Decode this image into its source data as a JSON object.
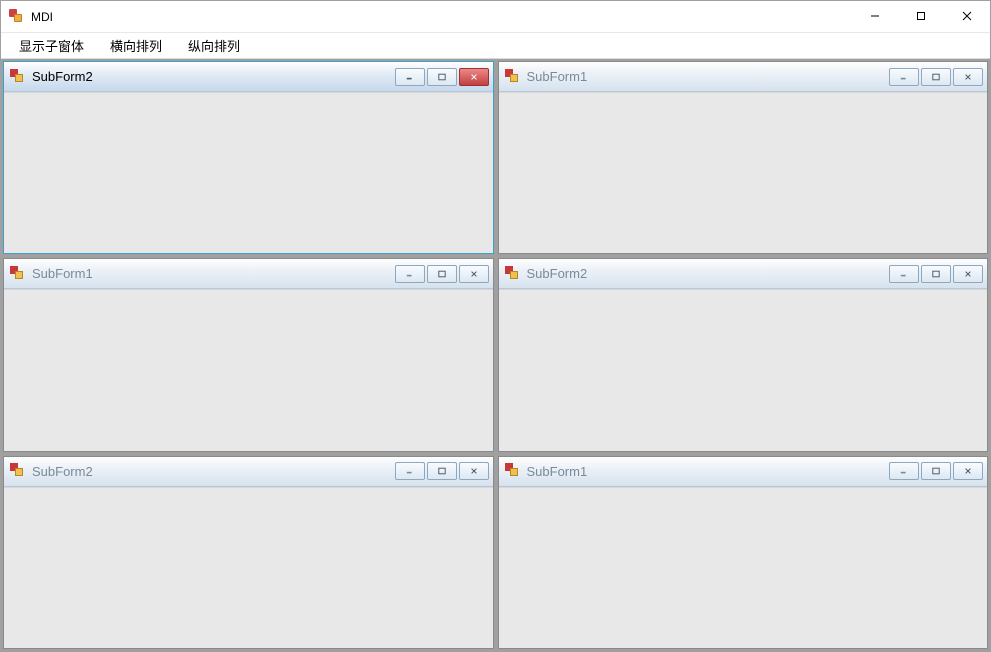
{
  "window": {
    "title": "MDI"
  },
  "menu": {
    "items": [
      {
        "label": "显示子窗体"
      },
      {
        "label": "横向排列"
      },
      {
        "label": "纵向排列"
      }
    ]
  },
  "children": [
    {
      "title": "SubForm2",
      "active": true
    },
    {
      "title": "SubForm1",
      "active": false
    },
    {
      "title": "SubForm1",
      "active": false
    },
    {
      "title": "SubForm2",
      "active": false
    },
    {
      "title": "SubForm2",
      "active": false
    },
    {
      "title": "SubForm1",
      "active": false
    }
  ]
}
